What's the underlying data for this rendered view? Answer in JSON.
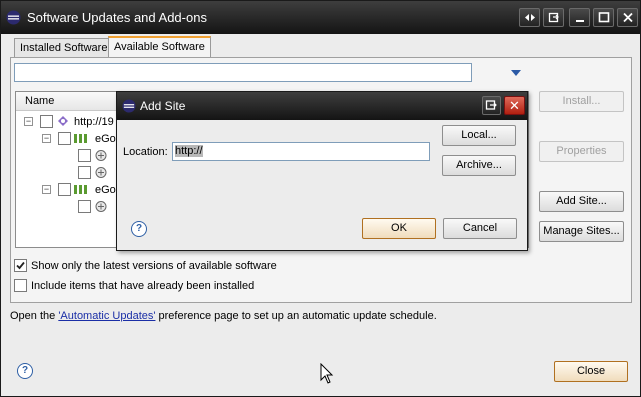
{
  "window": {
    "title": "Software Updates and Add-ons",
    "controls": [
      "sync-icon",
      "restore-icon",
      "minimize-icon",
      "maximize-icon",
      "close-icon"
    ]
  },
  "tabs": [
    {
      "label": "Installed Software",
      "active": false
    },
    {
      "label": "Available Software",
      "active": true
    }
  ],
  "filter": {
    "value": "",
    "placeholder": ""
  },
  "tree": {
    "header": "Name",
    "rows": [
      {
        "level": 0,
        "expander": "−",
        "text": "http://19",
        "icon": "site-icon"
      },
      {
        "level": 1,
        "expander": "−",
        "text": "eGo",
        "icon": "category-icon"
      },
      {
        "level": 2,
        "expander": "",
        "text": "",
        "icon": "feature-icon"
      },
      {
        "level": 2,
        "expander": "",
        "text": "",
        "icon": "feature-icon"
      },
      {
        "level": 1,
        "expander": "−",
        "text": "eGo",
        "icon": "category-icon"
      },
      {
        "level": 2,
        "expander": "",
        "text": "",
        "icon": "feature-icon"
      }
    ]
  },
  "side_buttons": {
    "install": "Install...",
    "properties": "Properties",
    "add_site": "Add Site...",
    "manage_sites": "Manage Sites..."
  },
  "options": {
    "show_latest": {
      "label": "Show only the latest versions of available software",
      "checked": true
    },
    "include_installed": {
      "label": "Include items that have already been installed",
      "checked": false
    }
  },
  "info": {
    "prefix": "Open the ",
    "link": "'Automatic Updates'",
    "suffix": " preference page to set up an automatic update schedule."
  },
  "close_label": "Close",
  "dialog": {
    "title": "Add Site",
    "location_label": "Location:",
    "location_value": "http://",
    "local_label": "Local...",
    "archive_label": "Archive...",
    "ok_label": "OK",
    "cancel_label": "Cancel"
  },
  "colors": {
    "titlebar": "#1e1e1e",
    "accent_orange": "#f0a030",
    "link_blue": "#1a2ea6",
    "dialog_close_red": "#c0301e"
  }
}
